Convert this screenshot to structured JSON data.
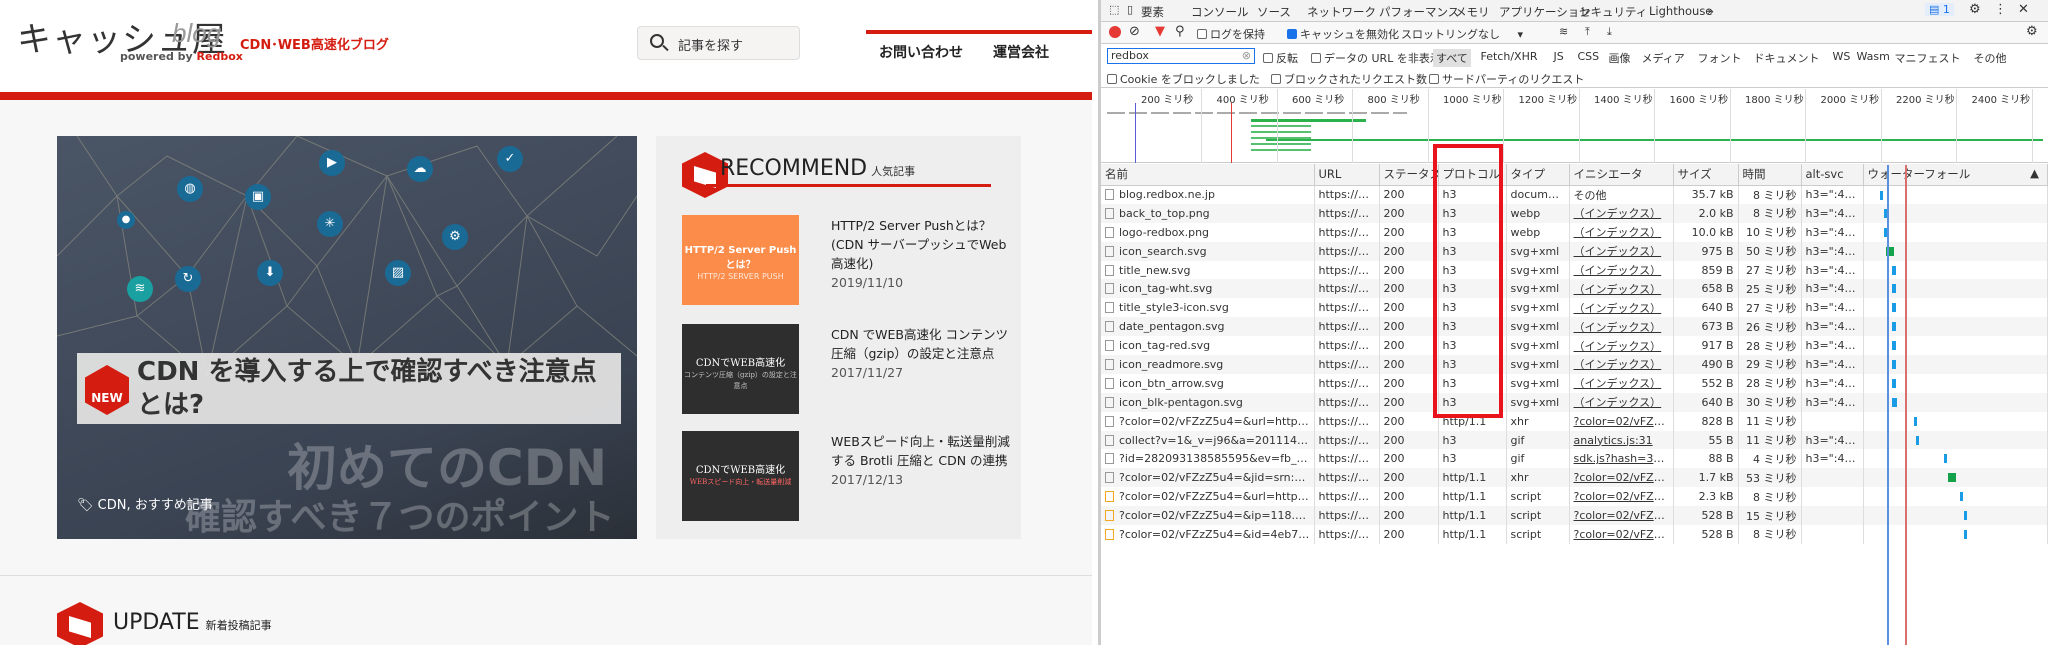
{
  "site": {
    "logo": "キャッシュ屋",
    "logo_sub": "blog",
    "powered_by": "powered by",
    "powered_brand": "Redbox",
    "tagline": "CDN･WEB高速化ブログ",
    "search_placeholder": "記事を探す",
    "nav": [
      "お問い合わせ",
      "運営会社"
    ],
    "hero": {
      "badge": "NEW",
      "title": "CDN を導入する上で確認すべき注意点とは?",
      "watermark1": "初めてのCDN",
      "watermark2": "確認すべき７つのポイント",
      "tags": "CDN, おすすめ記事"
    },
    "recommend": {
      "heading": "RECOMMEND",
      "sub": "人気記事",
      "items": [
        {
          "thumb": "HTTP/2 Server Pushとは？",
          "thumb_sub": "HTTP/2 SERVER PUSH",
          "title": "HTTP/2 Server Pushとは？(CDN サーバープッシュでWeb高速化)",
          "date": "2019/11/10"
        },
        {
          "thumb": "CDNでWEB高速化",
          "thumb_sub": "コンテンツ圧縮（gzip）の設定と注意点",
          "title": "CDN でWEB高速化 コンテンツ圧縮（gzip）の設定と注意点",
          "date": "2017/11/27"
        },
        {
          "thumb": "CDNでWEB高速化",
          "thumb_sub": "WEBスピード向上・転送量削減",
          "title": "WEBスピード向上・転送量削減する Brotli 圧縮と CDN の連携",
          "date": "2017/12/13"
        }
      ]
    },
    "update": {
      "heading": "UPDATE",
      "sub": "新着投稿記事"
    }
  },
  "devtools": {
    "tabs": [
      "要素",
      "コンソール",
      "ソース",
      "ネットワーク",
      "パフォーマンス",
      "メモリ",
      "アプリケーション",
      "セキュリティ",
      "Lighthouse",
      "»"
    ],
    "active_tab": "ネットワーク",
    "badge": "1",
    "toolbar": {
      "preserve_log": "ログを保持",
      "disable_cache": "キャッシュを無効化",
      "throttling": "スロットリングなし"
    },
    "filter": {
      "value": "redbox",
      "invert": "反転",
      "hide_data_urls": "データの URL を非表示",
      "types": [
        "すべて",
        "Fetch/XHR",
        "JS",
        "CSS",
        "画像",
        "メディア",
        "フォント",
        "ドキュメント",
        "WS",
        "Wasm",
        "マニフェスト",
        "その他"
      ],
      "blocked_cookies": "Cookie をブロックしました",
      "blocked_requests": "ブロックされたリクエスト数",
      "third_party": "サードパーティのリクエスト"
    },
    "overview_ticks": [
      "200 ミリ秒",
      "400 ミリ秒",
      "600 ミリ秒",
      "800 ミリ秒",
      "1000 ミリ秒",
      "1200 ミリ秒",
      "1400 ミリ秒",
      "1600 ミリ秒",
      "1800 ミリ秒",
      "2000 ミリ秒",
      "2200 ミリ秒",
      "2400 ミリ秒"
    ],
    "columns": [
      "名前",
      "URL",
      "ステータス",
      "プロトコル",
      "タイプ",
      "イニシエータ",
      "サイズ",
      "時間",
      "alt-svc",
      "ウォーターフォール"
    ],
    "rows": [
      [
        "blog.redbox.ne.jp",
        "https://bl...",
        "200",
        "h3",
        "document",
        "その他",
        "35.7 kB",
        "8 ミリ秒",
        "h3=\":443\"..."
      ],
      [
        "back_to_top.png",
        "https://bl...",
        "200",
        "h3",
        "webp",
        "（インデックス）",
        "2.0 kB",
        "8 ミリ秒",
        "h3=\":443\"..."
      ],
      [
        "logo-redbox.png",
        "https://bl...",
        "200",
        "h3",
        "webp",
        "（インデックス）",
        "10.0 kB",
        "10 ミリ秒",
        "h3=\":443\"..."
      ],
      [
        "icon_search.svg",
        "https://bl...",
        "200",
        "h3",
        "svg+xml",
        "（インデックス）",
        "975 B",
        "50 ミリ秒",
        "h3=\":443\"..."
      ],
      [
        "title_new.svg",
        "https://bl...",
        "200",
        "h3",
        "svg+xml",
        "（インデックス）",
        "859 B",
        "27 ミリ秒",
        "h3=\":443\"..."
      ],
      [
        "icon_tag-wht.svg",
        "https://bl...",
        "200",
        "h3",
        "svg+xml",
        "（インデックス）",
        "658 B",
        "25 ミリ秒",
        "h3=\":443\"..."
      ],
      [
        "title_style3-icon.svg",
        "https://bl...",
        "200",
        "h3",
        "svg+xml",
        "（インデックス）",
        "640 B",
        "27 ミリ秒",
        "h3=\":443\"..."
      ],
      [
        "date_pentagon.svg",
        "https://bl...",
        "200",
        "h3",
        "svg+xml",
        "（インデックス）",
        "673 B",
        "26 ミリ秒",
        "h3=\":443\"..."
      ],
      [
        "icon_tag-red.svg",
        "https://bl...",
        "200",
        "h3",
        "svg+xml",
        "（インデックス）",
        "917 B",
        "28 ミリ秒",
        "h3=\":443\"..."
      ],
      [
        "icon_readmore.svg",
        "https://bl...",
        "200",
        "h3",
        "svg+xml",
        "（インデックス）",
        "490 B",
        "29 ミリ秒",
        "h3=\":443\"..."
      ],
      [
        "icon_btn_arrow.svg",
        "https://bl...",
        "200",
        "h3",
        "svg+xml",
        "（インデックス）",
        "552 B",
        "28 ミリ秒",
        "h3=\":443\"..."
      ],
      [
        "icon_blk-pentagon.svg",
        "https://bl...",
        "200",
        "h3",
        "svg+xml",
        "（インデックス）",
        "640 B",
        "30 ミリ秒",
        "h3=\":443\"..."
      ],
      [
        "?color=02/vFZzZ5u4=&url=https%3...",
        "https://kit...",
        "200",
        "http/1.1",
        "xhr",
        "?color=02/vFZzZ5...",
        "828 B",
        "11 ミリ秒",
        ""
      ],
      [
        "collect?v=1&_v=j96&a=201114050&...",
        "https://w...",
        "200",
        "h3",
        "gif",
        "analytics.js:31",
        "55 B",
        "11 ミリ秒",
        "h3=\":443\"..."
      ],
      [
        "?id=282093138585595&ev=fb_page_...",
        "https://w...",
        "200",
        "h3",
        "gif",
        "sdk.js?hash=37e66...",
        "88 B",
        "4 ミリ秒",
        "h3=\":443\"..."
      ],
      [
        "?color=02/vFZzZ5u4=&jid=srn:smoo...",
        "https://kit...",
        "200",
        "http/1.1",
        "xhr",
        "?color=02/vFZzZ5...",
        "1.7 kB",
        "53 ミリ秒",
        ""
      ],
      [
        "?color=02/vFZzZ5u4=&url=https%3...",
        "https://kit...",
        "200",
        "http/1.1",
        "script",
        "?color=02/vFZzZ5...",
        "2.3 kB",
        "8 ミリ秒",
        ""
      ],
      [
        "?color=02/vFZzZ5u4=&ip=118.238.2...",
        "https://kit...",
        "200",
        "http/1.1",
        "script",
        "?color=02/vFZzZ5...",
        "528 B",
        "15 ミリ秒",
        ""
      ],
      [
        "?color=02/vFZzZ5u4=&id=4eb7ca61...",
        "https://kit...",
        "200",
        "http/1.1",
        "script",
        "?color=02/vFZzZ5...",
        "528 B",
        "8 ミリ秒",
        ""
      ]
    ]
  },
  "colors": {
    "brand_red": "#d51c10",
    "devtools_blue": "#1a73e8",
    "highlight_box": "#e8131b"
  }
}
